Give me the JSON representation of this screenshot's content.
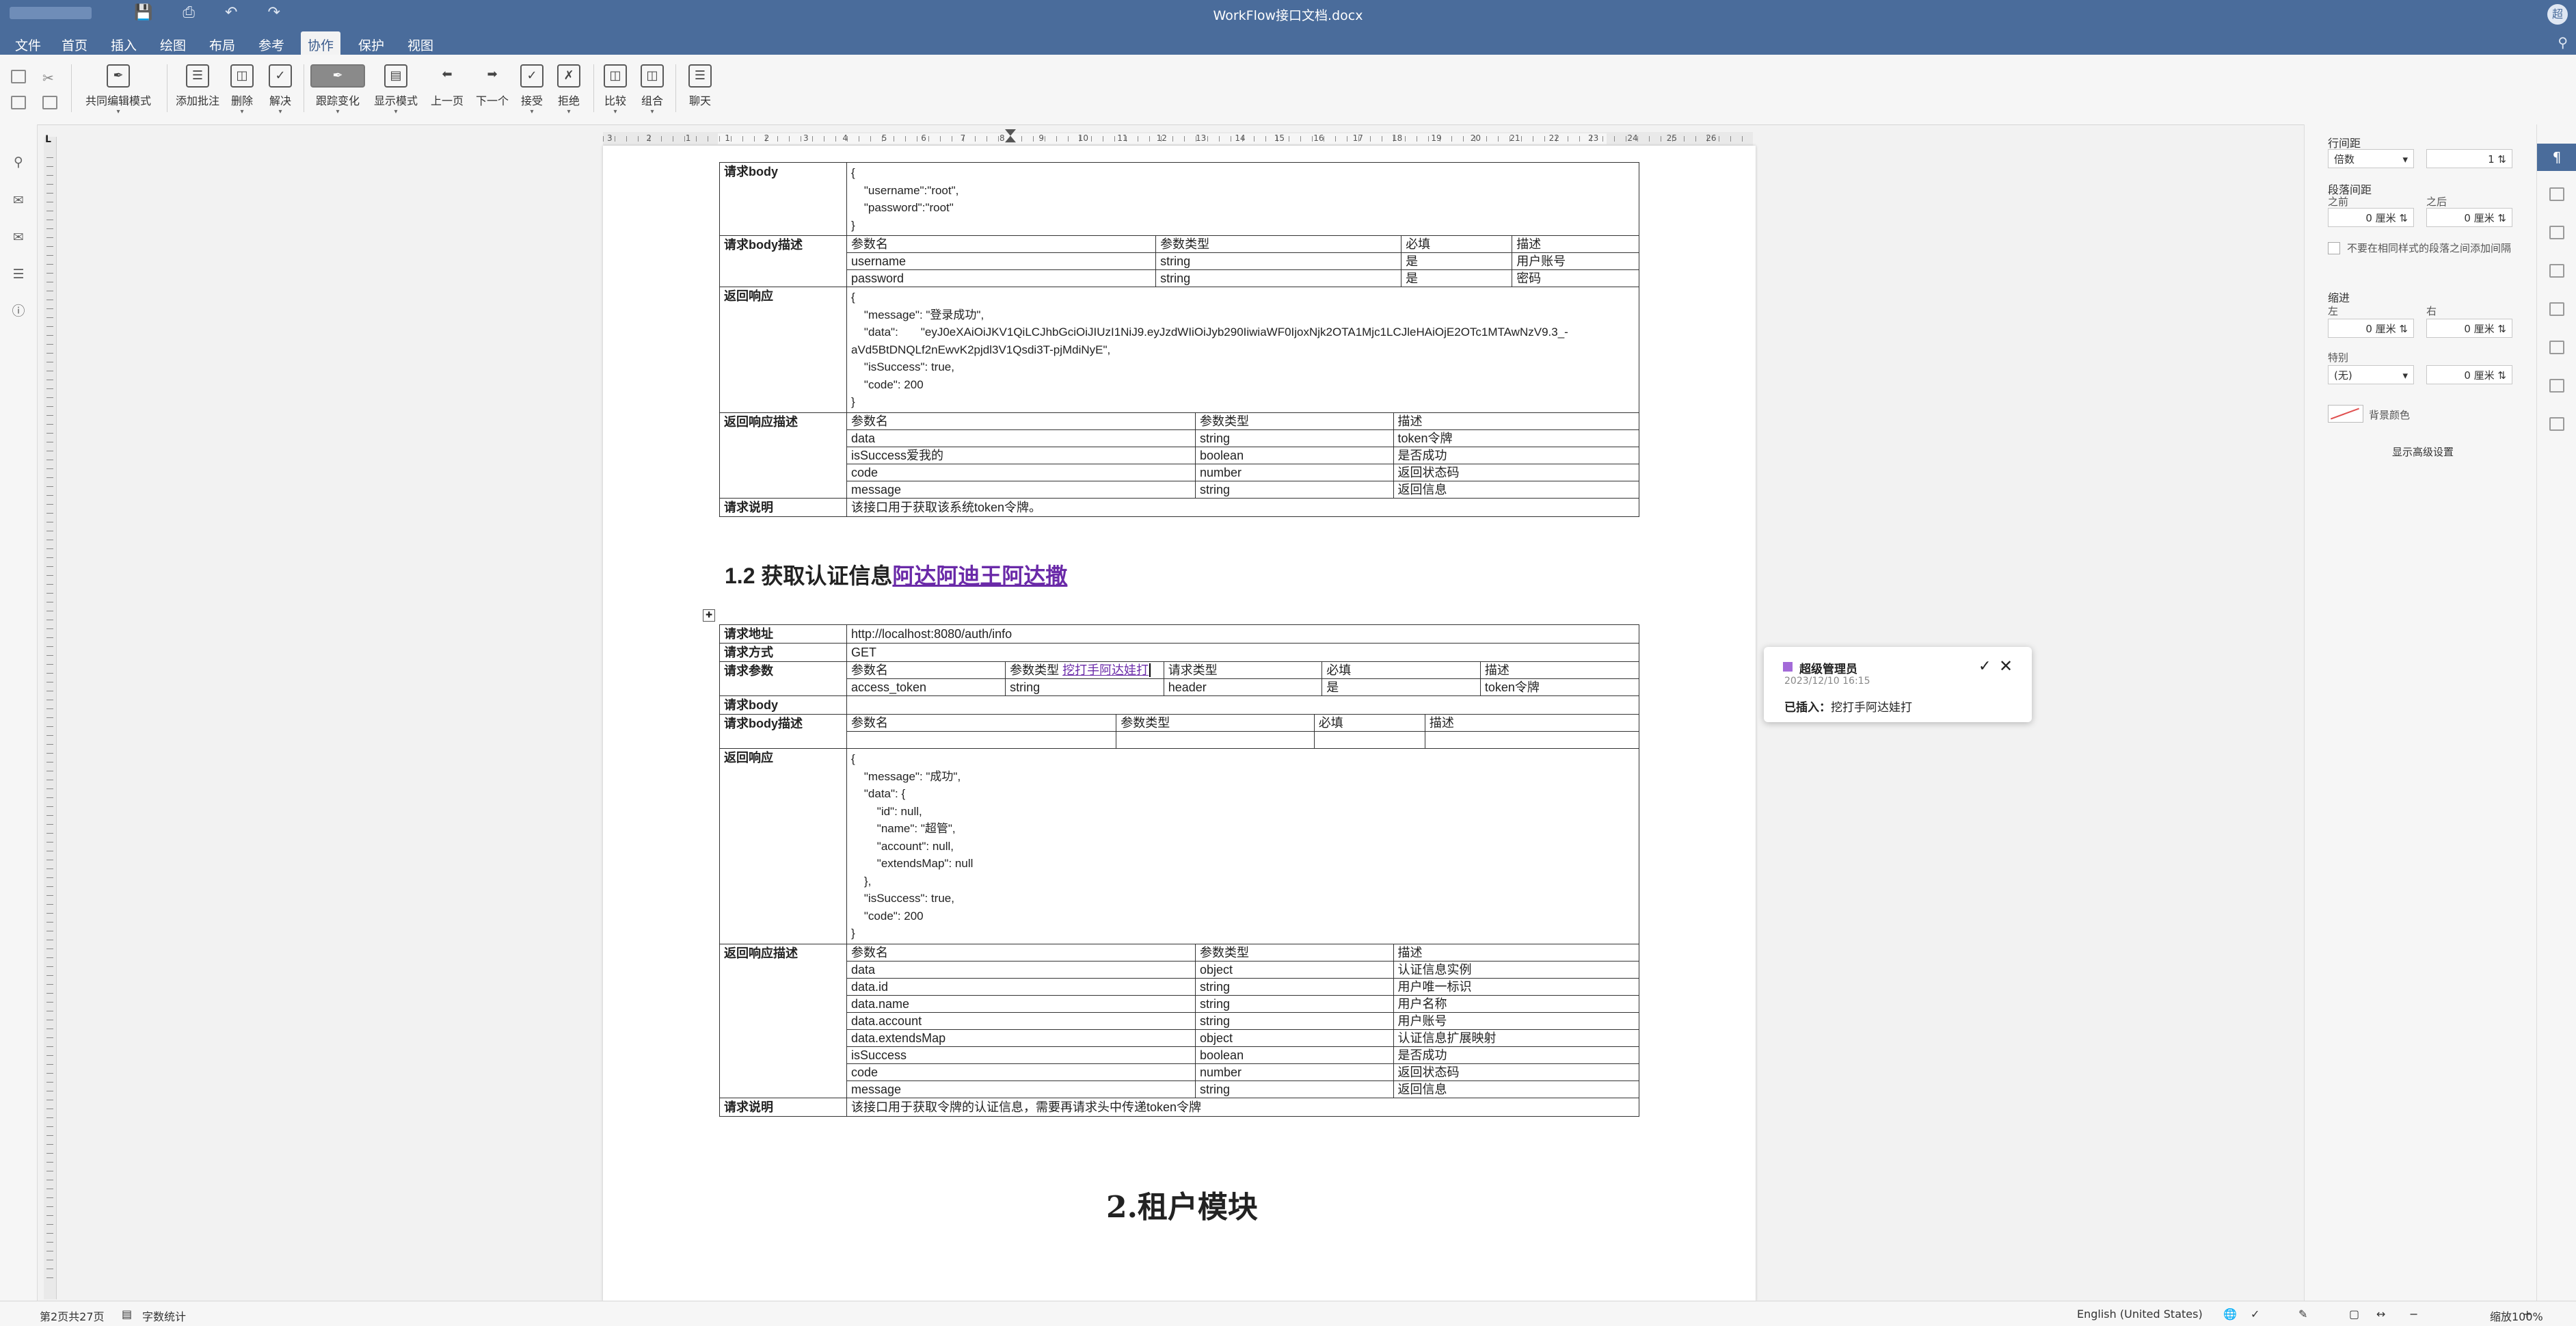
{
  "window": {
    "title": "WorkFlow接口文档.docx"
  },
  "menu": {
    "items": [
      "文件",
      "首页",
      "插入",
      "绘图",
      "布局",
      "参考",
      "协作",
      "保护",
      "视图"
    ],
    "active": "协作"
  },
  "ribbon": {
    "buttons": [
      "共同编辑模式",
      "添加批注",
      "删除",
      "解决",
      "跟踪变化",
      "显示模式",
      "上一页",
      "下一个",
      "接受",
      "拒绝",
      "比较",
      "组合",
      "聊天"
    ]
  },
  "doc": {
    "table1": {
      "rows": {
        "req_body_label": "请求body",
        "req_body": "{\n    \"username\":\"root\",\n    \"password\":\"root\"\n}",
        "req_body_desc_label": "请求body描述",
        "req_body_desc_head": [
          "参数名",
          "参数类型",
          "必填",
          "描述"
        ],
        "req_body_desc_rows": [
          [
            "username",
            "string",
            "是",
            "用户账号"
          ],
          [
            "password",
            "string",
            "是",
            "密码"
          ]
        ],
        "resp_label": "返回响应",
        "resp": "{\n    \"message\": \"登录成功\",\n    \"data\":       \"eyJ0eXAiOiJKV1QiLCJhbGciOiJIUzI1NiJ9.eyJzdWIiOiJyb290IiwiaWF0IjoxNjk2OTA1Mjc1LCJleHAiOjE2OTc1MTAwNzV9.3_-\naVd5BtDNQLf2nEwvK2pjdl3V1Qsdi3T-pjMdiNyE\",\n    \"isSuccess\": true,\n    \"code\": 200\n}",
        "resp_desc_label": "返回响应描述",
        "resp_desc_head": [
          "参数名",
          "参数类型",
          "描述"
        ],
        "resp_desc_rows": [
          [
            "data",
            "string",
            "token令牌"
          ],
          [
            "isSuccess爱我的",
            "boolean",
            "是否成功"
          ],
          [
            "code",
            "number",
            "返回状态码"
          ],
          [
            "message",
            "string",
            "返回信息"
          ]
        ],
        "note_label": "请求说明",
        "note": "该接口用于获取该系统token令牌。"
      }
    },
    "section12": {
      "prefix": "1.2  获取认证信息",
      "inserted": "阿达阿迪王阿达撒"
    },
    "table2": {
      "url_label": "请求地址",
      "url": "http://localhost:8080/auth/info",
      "method_label": "请求方式",
      "method": "GET",
      "params_label": "请求参数",
      "params_head": [
        "参数名",
        "参数类型 ",
        "挖打手阿达娃打",
        "请求类型",
        "必填",
        "描述"
      ],
      "params_rows": [
        [
          "access_token",
          "string",
          "header",
          "是",
          "token令牌"
        ]
      ],
      "body_label": "请求body",
      "body_desc_label": "请求body描述",
      "body_desc_head": [
        "参数名",
        "参数类型",
        "必填",
        "描述"
      ],
      "resp_label": "返回响应",
      "resp": "{\n    \"message\": \"成功\",\n    \"data\": {\n        \"id\": null,\n        \"name\": \"超管\",\n        \"account\": null,\n        \"extendsMap\": null\n    },\n    \"isSuccess\": true,\n    \"code\": 200\n}",
      "resp_desc_label": "返回响应描述",
      "resp_desc_head": [
        "参数名",
        "参数类型",
        "描述"
      ],
      "resp_desc_rows": [
        [
          "data",
          "object",
          "认证信息实例"
        ],
        [
          "data.id",
          "string",
          "用户唯一标识"
        ],
        [
          "data.name",
          "string",
          "用户名称"
        ],
        [
          "data.account",
          "string",
          "用户账号"
        ],
        [
          "data.extendsMap",
          "object",
          "认证信息扩展映射"
        ],
        [
          "isSuccess",
          "boolean",
          "是否成功"
        ],
        [
          "code",
          "number",
          "返回状态码"
        ],
        [
          "message",
          "string",
          "返回信息"
        ]
      ],
      "note_label": "请求说明",
      "note": "该接口用于获取令牌的认证信息，需要再请求头中传递token令牌"
    },
    "chapter2": "2.租户模块"
  },
  "comment": {
    "author": "超级管理员",
    "time": "2023/12/10 16:15",
    "label": "已插入：",
    "text": "挖打手阿达娃打",
    "color": "#a36ad8"
  },
  "panel": {
    "line_spacing": "行间距",
    "line_spacing_mode": "倍数",
    "line_spacing_value": "1",
    "para_spacing": "段落间距",
    "before": "之前",
    "after": "之后",
    "before_val": "0 厘米",
    "after_val": "0 厘米",
    "no_space_same": "不要在相同样式的段落之间添加间隔",
    "indent": "缩进",
    "left": "左",
    "right": "右",
    "left_val": "0 厘米",
    "right_val": "0 厘米",
    "special": "特别",
    "special_mode": "(无)",
    "special_val": "0 厘米",
    "bg_color": "背景颜色",
    "advanced": "显示高级设置"
  },
  "status": {
    "page": "第2页共27页",
    "word_count": "字数统计",
    "language": "English (United States)",
    "zoom": "缩放100%"
  },
  "ruler_numbers": [
    "3",
    "2",
    "1",
    "1",
    "2",
    "3",
    "4",
    "5",
    "6",
    "7",
    "8",
    "9",
    "10",
    "11",
    "12",
    "13",
    "14",
    "15",
    "16",
    "17",
    "18",
    "19",
    "20",
    "21",
    "22",
    "23",
    "24",
    "25",
    "26"
  ]
}
